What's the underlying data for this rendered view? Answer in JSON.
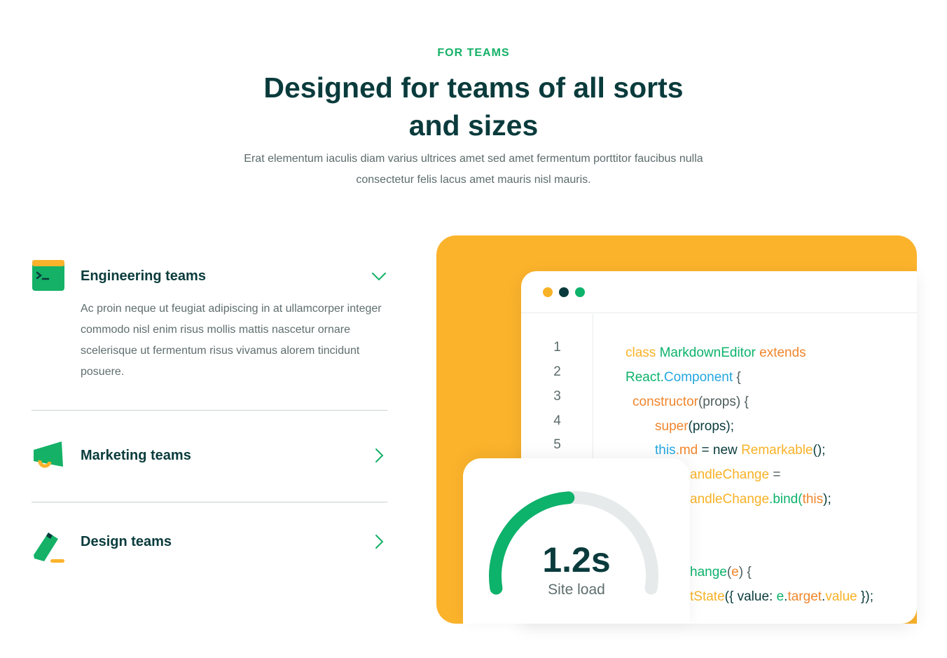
{
  "header": {
    "eyebrow": "FOR TEAMS",
    "title": "Designed for teams of all sorts and sizes",
    "subtitle": "Erat elementum iaculis diam varius ultrices amet sed amet fermentum porttitor faucibus nulla consectetur felis lacus amet mauris nisl mauris."
  },
  "teams": [
    {
      "title": "Engineering teams",
      "icon": "terminal-icon",
      "expanded": true,
      "body": "Ac proin neque ut feugiat adipiscing in at ullamcorper integer commodo nisl enim risus mollis mattis nascetur ornare scelerisque ut fermentum risus vivamus alorem tincidunt posuere."
    },
    {
      "title": "Marketing teams",
      "icon": "megaphone-icon",
      "expanded": false
    },
    {
      "title": "Design teams",
      "icon": "pencil-icon",
      "expanded": false
    }
  ],
  "editor": {
    "window_dots": [
      "#f8b227",
      "#0a3b3c",
      "#0db26b"
    ],
    "line_numbers": [
      "1",
      "2",
      "3",
      "4",
      "5"
    ],
    "code": {
      "l1_kw": "class",
      "l1_name": "MarkdownEditor",
      "l1_ext": "extends",
      "l2_react": "React.",
      "l2_comp": "Component",
      "l2_brace": " {",
      "l3_ctor": "constructor",
      "l3_rest": "(props) {",
      "l4_super": "super",
      "l4_rest": "(props);",
      "l5_this": "this",
      "l5_md": ".md",
      "l5_eq": " = new ",
      "l5_rem": "Remarkable",
      "l5_end": "();",
      "l6_a": "andleChange",
      "l6_b": " =",
      "l7_a": "andleChange",
      "l7_b": ".bind(",
      "l7_c": "this",
      "l7_d": ");",
      "l8_a": "hange",
      "l8_b": "(",
      "l8_c": "e",
      "l8_d": ") {",
      "l9_a": "tState",
      "l9_b": "({ value: ",
      "l9_c": "e",
      "l9_d": ".",
      "l9_e": "target",
      "l9_f": ".",
      "l9_g": "value",
      "l9_h": " });"
    }
  },
  "gauge": {
    "value": "1.2s",
    "label": "Site load",
    "fill_fraction": 0.48,
    "track_color": "#e6eaea",
    "fill_color": "#0db26b"
  },
  "colors": {
    "accent_green": "#14b167",
    "accent_yellow": "#fbb32c",
    "heading": "#0a3b3c"
  }
}
